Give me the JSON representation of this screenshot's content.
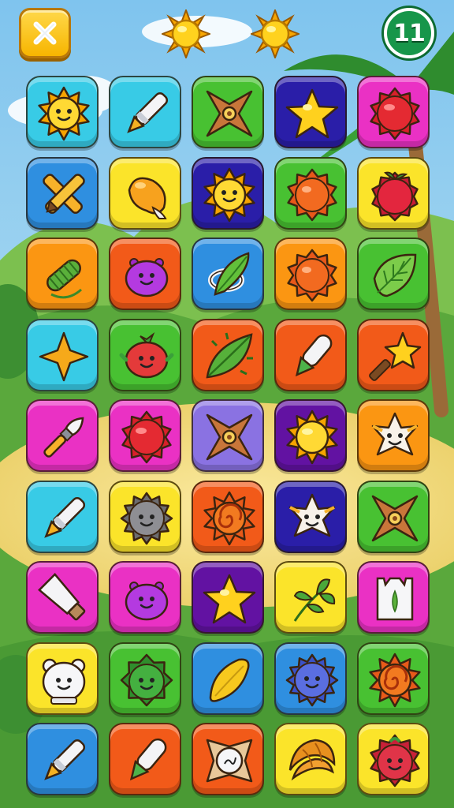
{
  "screen": {
    "background": {
      "sky_top": "#7fc4ee",
      "sky_bottom": "#cdeaf3",
      "hills_far": "#6fb84a",
      "hills_near": "#4d9a36",
      "sand": "#f3dd7d",
      "palm_leaf": "#2f8c2e",
      "palm_trunk": "#9a6a38"
    }
  },
  "hud": {
    "close_icon": "close-x-icon",
    "suns": [
      {
        "icon": "sun-icon"
      },
      {
        "icon": "sun-icon"
      }
    ],
    "moves_left": "11"
  },
  "palette": {
    "cyan": "#38cbe6",
    "yellow": "#fbe42a",
    "green": "#48c132",
    "navy": "#2a1ea8",
    "magenta": "#ea31c4",
    "blue": "#2f8fe0",
    "orange": "#fb9612",
    "red": "#f25a19",
    "violet": "#8a72e2",
    "purple": "#6212a2"
  },
  "board": {
    "columns": 5,
    "rows": 9,
    "tiles": [
      {
        "bg": "cyan",
        "icon": "sun-face-icon"
      },
      {
        "bg": "cyan",
        "icon": "crayon-icon"
      },
      {
        "bg": "green",
        "icon": "shuriken-icon"
      },
      {
        "bg": "navy",
        "icon": "star-icon"
      },
      {
        "bg": "magenta",
        "icon": "red-spiky-ball-icon"
      },
      {
        "bg": "blue",
        "icon": "crossed-crayons-icon"
      },
      {
        "bg": "yellow",
        "icon": "mango-icon"
      },
      {
        "bg": "navy",
        "icon": "sun-face-icon"
      },
      {
        "bg": "green",
        "icon": "orange-spiky-ball-icon"
      },
      {
        "bg": "yellow",
        "icon": "red-berry-icon"
      },
      {
        "bg": "orange",
        "icon": "caterpillar-icon"
      },
      {
        "bg": "red",
        "icon": "purple-blob-icon"
      },
      {
        "bg": "blue",
        "icon": "leaf-ring-icon"
      },
      {
        "bg": "orange",
        "icon": "orange-spiky-ball-icon"
      },
      {
        "bg": "green",
        "icon": "leaf-icon"
      },
      {
        "bg": "cyan",
        "icon": "orange-star-icon"
      },
      {
        "bg": "green",
        "icon": "tomato-face-icon"
      },
      {
        "bg": "red",
        "icon": "spiky-leaf-icon"
      },
      {
        "bg": "red",
        "icon": "white-crayon-icon"
      },
      {
        "bg": "red",
        "icon": "star-wand-icon"
      },
      {
        "bg": "magenta",
        "icon": "brush-icon"
      },
      {
        "bg": "magenta",
        "icon": "red-spiky-ball-icon"
      },
      {
        "bg": "violet",
        "icon": "shuriken-icon"
      },
      {
        "bg": "purple",
        "icon": "sun-icon"
      },
      {
        "bg": "orange",
        "icon": "white-star-face-icon"
      },
      {
        "bg": "cyan",
        "icon": "crayon-icon"
      },
      {
        "bg": "yellow",
        "icon": "gray-spiky-face-icon"
      },
      {
        "bg": "red",
        "icon": "swirl-sun-icon"
      },
      {
        "bg": "navy",
        "icon": "white-star-face-icon"
      },
      {
        "bg": "green",
        "icon": "shuriken-icon"
      },
      {
        "bg": "magenta",
        "icon": "paint-tube-icon"
      },
      {
        "bg": "magenta",
        "icon": "purple-blob-icon"
      },
      {
        "bg": "purple",
        "icon": "star-icon"
      },
      {
        "bg": "yellow",
        "icon": "leaf-sprig-icon"
      },
      {
        "bg": "magenta",
        "icon": "paper-bag-icon"
      },
      {
        "bg": "yellow",
        "icon": "bear-face-icon"
      },
      {
        "bg": "green",
        "icon": "green-spiky-face-icon"
      },
      {
        "bg": "blue",
        "icon": "mango-leaf-icon"
      },
      {
        "bg": "blue",
        "icon": "blue-spiky-face-icon"
      },
      {
        "bg": "green",
        "icon": "swirl-sun-icon"
      },
      {
        "bg": "blue",
        "icon": "crayon-icon"
      },
      {
        "bg": "red",
        "icon": "white-crayon-icon"
      },
      {
        "bg": "red",
        "icon": "clock-face-icon"
      },
      {
        "bg": "yellow",
        "icon": "croissant-icon"
      },
      {
        "bg": "yellow",
        "icon": "red-spiky-face-icon"
      }
    ]
  }
}
